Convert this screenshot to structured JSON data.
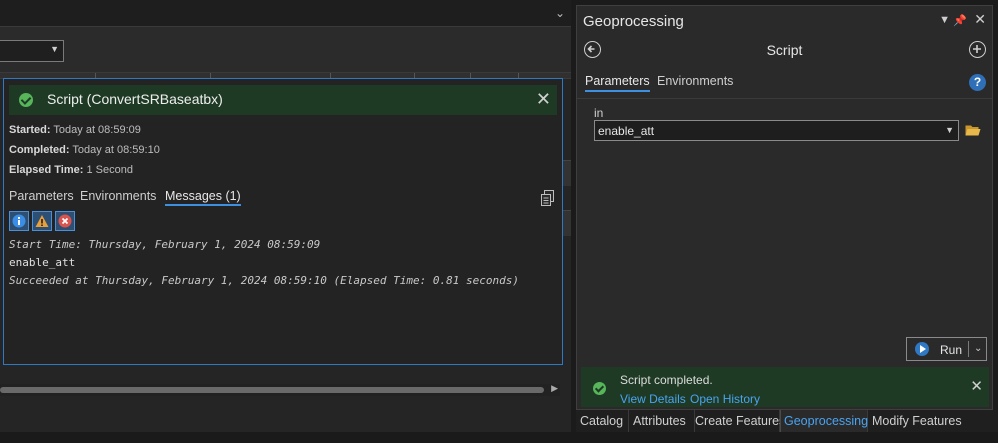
{
  "left": {
    "job": {
      "title": "Script (ConvertSRBaseatbx)",
      "started_label": "Started:",
      "started_value": "Today at 08:59:09",
      "completed_label": "Completed:",
      "completed_value": "Today at 08:59:10",
      "elapsed_label": "Elapsed Time:",
      "elapsed_value": "1 Second",
      "tabs": [
        "Parameters",
        "Environments",
        "Messages (1)"
      ],
      "active_tab": "Messages (1)",
      "messages": [
        "Start Time: Thursday, February 1, 2024 08:59:09",
        "enable_att",
        "Succeeded at Thursday, February 1, 2024 08:59:10 (Elapsed Time: 0.81 seconds)"
      ],
      "filter_icons": [
        "info-icon",
        "warning-icon",
        "error-icon"
      ]
    }
  },
  "geoprocessing": {
    "panel_title": "Geoprocessing",
    "tool_name": "Script",
    "tabs": [
      "Parameters",
      "Environments"
    ],
    "active_tab": "Parameters",
    "param_label": "in",
    "param_value": "enable_att",
    "run_label": "Run",
    "status": {
      "text": "Script completed.",
      "view_details": "View Details",
      "open_history": "Open History"
    }
  },
  "bottom_tabs": [
    "Catalog",
    "Attributes",
    "Create Features",
    "Geoprocessing",
    "Modify Features"
  ],
  "active_bottom_tab": "Geoprocessing",
  "colors": {
    "accent": "#3d8fe0",
    "success": "#57b55a",
    "success_bg": "#1e3a24",
    "link": "#4aa3f0"
  }
}
